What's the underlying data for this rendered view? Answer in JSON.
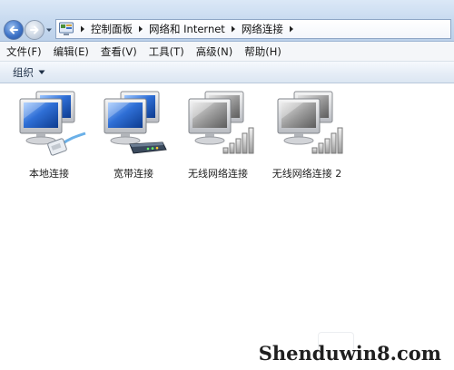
{
  "breadcrumb": {
    "items": [
      "控制面板",
      "网络和 Internet",
      "网络连接"
    ]
  },
  "menu": {
    "items": [
      "文件(F)",
      "编辑(E)",
      "查看(V)",
      "工具(T)",
      "高级(N)",
      "帮助(H)"
    ]
  },
  "command_bar": {
    "organize_label": "组织"
  },
  "connections": [
    {
      "label": "本地连接",
      "kind": "lan",
      "icon": "lan-cable-icon"
    },
    {
      "label": "宽带连接",
      "kind": "broadband",
      "icon": "modem-icon"
    },
    {
      "label": "无线网络连接",
      "kind": "wireless",
      "icon": "signal-bars-icon"
    },
    {
      "label": "无线网络连接 2",
      "kind": "wireless",
      "icon": "signal-bars-icon"
    }
  ],
  "watermark": {
    "text": "Shenduwin8.com"
  },
  "colors": {
    "addr_bar": "#c6d9ef",
    "command_bar": "#e7eef7",
    "monitor_screen": "#2f6fd6",
    "disabled_screen": "#8e8e8e"
  }
}
